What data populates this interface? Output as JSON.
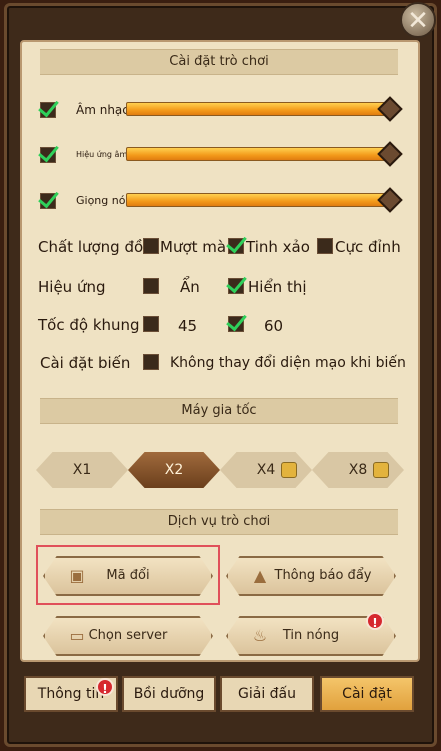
{
  "title": "Cài đặt trò chơi",
  "close_label": "✕",
  "audio": [
    {
      "label": "Âm nhạc",
      "checked": true,
      "level": 1.0
    },
    {
      "label": "Hiệu ứng âm",
      "checked": true,
      "level": 1.0
    },
    {
      "label": "Giọng nói",
      "checked": true,
      "level": 1.0
    }
  ],
  "quality": {
    "label": "Chất lượng đồ",
    "options": [
      {
        "label": "Mượt mà",
        "checked": false
      },
      {
        "label": "Tinh xảo",
        "checked": true
      },
      {
        "label": "Cực đỉnh",
        "checked": false
      }
    ]
  },
  "effects": {
    "label": "Hiệu ứng",
    "options": [
      {
        "label": "Ẩn",
        "checked": false
      },
      {
        "label": "Hiển thị",
        "checked": true
      }
    ]
  },
  "framerate": {
    "label": "Tốc độ khung",
    "options": [
      {
        "label": "45",
        "checked": false
      },
      {
        "label": "60",
        "checked": true
      }
    ]
  },
  "transform": {
    "label": "Cài đặt biến",
    "option": {
      "label": "Không thay đổi diện mạo khi biến",
      "checked": false
    }
  },
  "accelerator": {
    "title": "Máy gia tốc",
    "options": [
      {
        "label": "X1",
        "active": false,
        "locked": false
      },
      {
        "label": "X2",
        "active": true,
        "locked": false
      },
      {
        "label": "X4",
        "active": false,
        "locked": true
      },
      {
        "label": "X8",
        "active": false,
        "locked": true
      }
    ]
  },
  "services": {
    "title": "Dịch vụ trò chơi",
    "buttons": [
      {
        "label": "Mã đổi",
        "icon": "gift-icon"
      },
      {
        "label": "Thông báo đẩy",
        "icon": "bell-icon"
      },
      {
        "label": "Chọn server",
        "icon": "scroll-icon"
      },
      {
        "label": "Tin nóng",
        "icon": "fire-icon",
        "badge": "!"
      }
    ]
  },
  "tabs": [
    {
      "label": "Thông tin",
      "badge": "!",
      "active": false
    },
    {
      "label": "Bồi dưỡng",
      "active": false
    },
    {
      "label": "Giải đấu",
      "active": false
    },
    {
      "label": "Cài đặt",
      "active": true
    }
  ]
}
